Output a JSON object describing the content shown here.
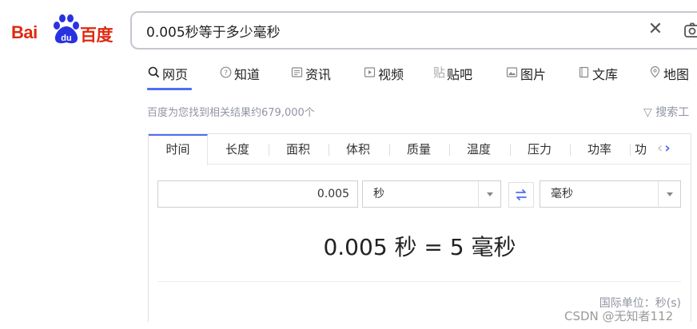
{
  "logo": {
    "bai": "Bai",
    "du": "du",
    "baidu_cn": "百度"
  },
  "search": {
    "query": "0.005秒等于多少毫秒"
  },
  "nav": {
    "items": [
      {
        "label": "网页",
        "icon": "search-icon"
      },
      {
        "label": "知道",
        "icon": "question-icon"
      },
      {
        "label": "资讯",
        "icon": "news-icon"
      },
      {
        "label": "视频",
        "icon": "video-icon"
      },
      {
        "label": "贴吧",
        "icon": "tieba-icon"
      },
      {
        "label": "图片",
        "icon": "image-icon"
      },
      {
        "label": "文库",
        "icon": "doc-icon"
      },
      {
        "label": "地图",
        "icon": "map-icon"
      }
    ]
  },
  "results": {
    "count_text": "百度为您找到相关结果约679,000个",
    "tools_label": "搜索工"
  },
  "converter": {
    "categories": [
      "时间",
      "长度",
      "面积",
      "体积",
      "质量",
      "温度",
      "压力",
      "功率",
      "功"
    ],
    "value": "0.005",
    "from_unit": "秒",
    "to_unit": "毫秒",
    "result": "0.005 秒 = 5 毫秒",
    "intl_unit": "国际单位：秒(s)"
  },
  "watermark": "CSDN @无知者112",
  "colors": {
    "accent": "#4e6ef2",
    "brand_red": "#de2910",
    "brand_blue": "#2932e1",
    "muted": "#9195a3"
  }
}
